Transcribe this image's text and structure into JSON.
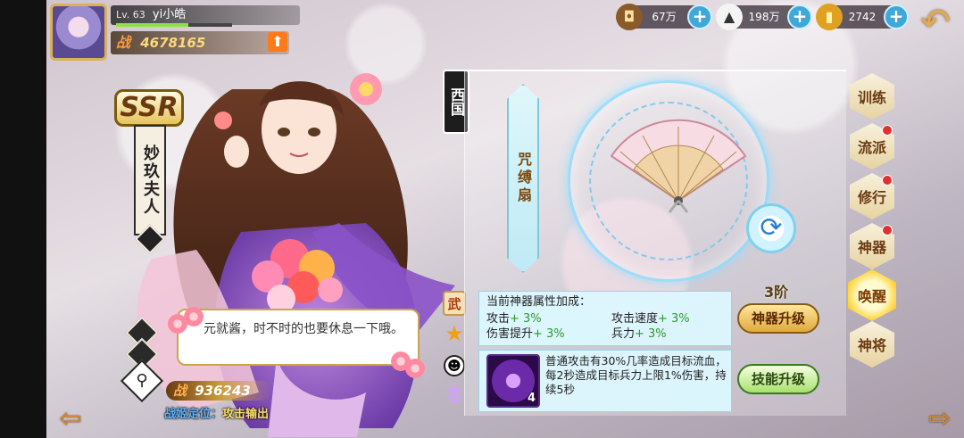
{
  "player": {
    "level_label": "Lv. 63",
    "name": "yi小皓",
    "power_icon": "战",
    "power": "4678165",
    "exp_fraction": 0.62
  },
  "currencies": [
    {
      "icon": "coin-icon",
      "value": "67万"
    },
    {
      "icon": "rice-ball-icon",
      "value": "198万"
    },
    {
      "icon": "gold-bar-icon",
      "value": "2742"
    }
  ],
  "character": {
    "rarity": "SSR",
    "name": "妙玖夫人",
    "quote": "元就酱，时不时的也要休息一下哦。",
    "power_icon": "战",
    "power": "936243",
    "role_label": "战姬定位：",
    "role_value": "攻击输出",
    "region": "西国",
    "type_emblem": "武"
  },
  "artifact": {
    "name": "咒缚扇",
    "tier": "3阶",
    "upgrade_label": "神器升级",
    "skill_upgrade_label": "技能升级",
    "bonus_title": "当前神器属性加成：",
    "bonuses": [
      {
        "name": "攻击",
        "value": "+ 3%"
      },
      {
        "name": "攻击速度",
        "value": "+ 3%"
      },
      {
        "name": "伤害提升",
        "value": "+ 3%"
      },
      {
        "name": "兵力",
        "value": "+ 3%"
      }
    ],
    "skill_level": "4",
    "skill_desc": "普通攻击有30%几率造成目标流血，每2秒造成目标兵力上限1%伤害，持续5秒"
  },
  "tabs": [
    {
      "label": "训练",
      "badge": false
    },
    {
      "label": "流派",
      "badge": true
    },
    {
      "label": "修行",
      "badge": true
    },
    {
      "label": "神器",
      "badge": true
    },
    {
      "label": "唤醒",
      "badge": false,
      "active": true
    },
    {
      "label": "神将",
      "badge": false
    }
  ],
  "colors": {
    "accent_gold": "#e0a840",
    "highlight_blue": "#3ea9d8",
    "bonus_green": "#2a9a2a",
    "role_blue": "#5fb4ff"
  }
}
